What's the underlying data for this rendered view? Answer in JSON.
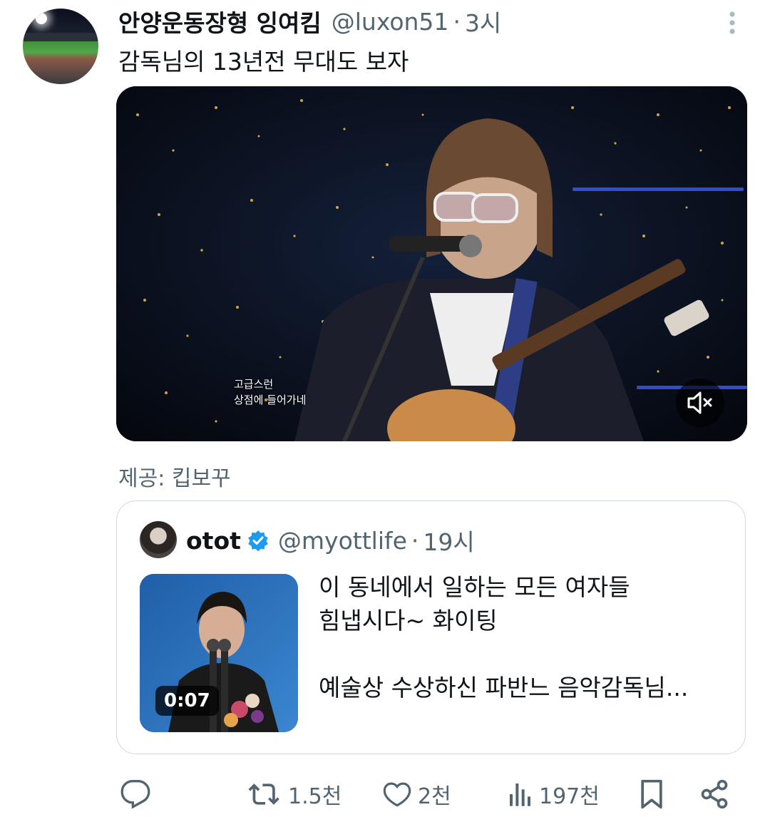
{
  "tweet": {
    "display_name": "안양운동장형 잉여킴",
    "handle": "@luxon51",
    "separator": "·",
    "time": "3시",
    "text": "감독님의 13년전 무대도 보자",
    "media_caption_line1": "고급스런",
    "media_caption_line2": "상점에 들어가네",
    "provided_by": "제공: 킵보꾸"
  },
  "quote": {
    "display_name": "otot",
    "handle": "@myottlife",
    "separator": "·",
    "time": "19시",
    "duration": "0:07",
    "text_line1": "이 동네에서 일하는 모든 여자들",
    "text_line2": "힘냅시다~ 화이팅",
    "text_line3": "예술상 수상하신 파반느 음악감독님..."
  },
  "actions": {
    "reply_icon": "reply-icon",
    "retweet_icon": "retweet-icon",
    "retweet_count": "1.5천",
    "like_icon": "heart-icon",
    "like_count": "2천",
    "views_icon": "views-icon",
    "views_count": "197천",
    "bookmark_icon": "bookmark-icon",
    "share_icon": "share-icon"
  },
  "colors": {
    "text_primary": "#0f1419",
    "text_secondary": "#536471",
    "verified_blue": "#1d9bf0",
    "border": "#cfd9de"
  }
}
